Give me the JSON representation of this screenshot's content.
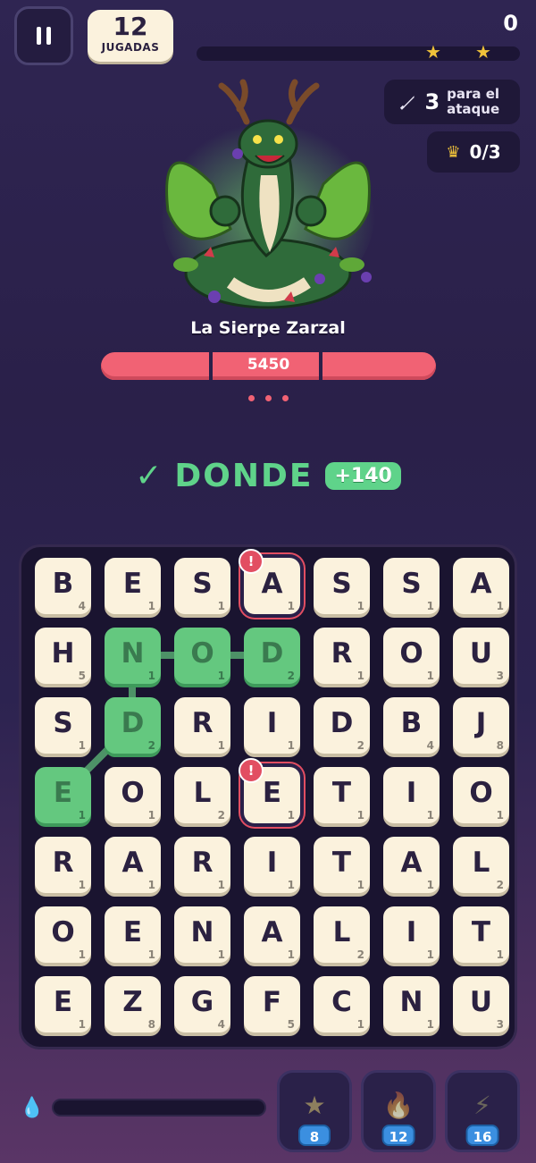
{
  "hud": {
    "moves": "12",
    "moves_label": "JUGADAS",
    "score": "0",
    "attack_count": "3",
    "attack_label": "para el ataque",
    "crowns": "0/3"
  },
  "boss": {
    "name": "La Sierpe Zarzal",
    "hp": "5450"
  },
  "current_word": {
    "word": "DONDE",
    "bonus": "+140"
  },
  "board": {
    "rows": [
      [
        {
          "l": "B",
          "v": "4"
        },
        {
          "l": "E",
          "v": "1"
        },
        {
          "l": "S",
          "v": "1"
        },
        {
          "l": "A",
          "v": "1",
          "warn": true
        },
        {
          "l": "S",
          "v": "1"
        },
        {
          "l": "S",
          "v": "1"
        },
        {
          "l": "A",
          "v": "1"
        }
      ],
      [
        {
          "l": "H",
          "v": "5"
        },
        {
          "l": "N",
          "v": "1",
          "sel": true
        },
        {
          "l": "O",
          "v": "1",
          "sel": true
        },
        {
          "l": "D",
          "v": "2",
          "sel": true
        },
        {
          "l": "R",
          "v": "1"
        },
        {
          "l": "O",
          "v": "1"
        },
        {
          "l": "U",
          "v": "3"
        }
      ],
      [
        {
          "l": "S",
          "v": "1"
        },
        {
          "l": "D",
          "v": "2",
          "sel": true
        },
        {
          "l": "R",
          "v": "1"
        },
        {
          "l": "I",
          "v": "1"
        },
        {
          "l": "D",
          "v": "2"
        },
        {
          "l": "B",
          "v": "4"
        },
        {
          "l": "J",
          "v": "8"
        }
      ],
      [
        {
          "l": "E",
          "v": "1",
          "sel": true
        },
        {
          "l": "O",
          "v": "1"
        },
        {
          "l": "L",
          "v": "2"
        },
        {
          "l": "E",
          "v": "1",
          "warn": true
        },
        {
          "l": "T",
          "v": "1"
        },
        {
          "l": "I",
          "v": "1"
        },
        {
          "l": "O",
          "v": "1"
        }
      ],
      [
        {
          "l": "R",
          "v": "1"
        },
        {
          "l": "A",
          "v": "1"
        },
        {
          "l": "R",
          "v": "1"
        },
        {
          "l": "I",
          "v": "1"
        },
        {
          "l": "T",
          "v": "1"
        },
        {
          "l": "A",
          "v": "1"
        },
        {
          "l": "L",
          "v": "2"
        }
      ],
      [
        {
          "l": "O",
          "v": "1"
        },
        {
          "l": "E",
          "v": "1"
        },
        {
          "l": "N",
          "v": "1"
        },
        {
          "l": "A",
          "v": "1"
        },
        {
          "l": "L",
          "v": "2"
        },
        {
          "l": "I",
          "v": "1"
        },
        {
          "l": "T",
          "v": "1"
        }
      ],
      [
        {
          "l": "E",
          "v": "1"
        },
        {
          "l": "Z",
          "v": "8"
        },
        {
          "l": "G",
          "v": "4"
        },
        {
          "l": "F",
          "v": "5"
        },
        {
          "l": "C",
          "v": "1"
        },
        {
          "l": "N",
          "v": "1"
        },
        {
          "l": "U",
          "v": "3"
        }
      ]
    ],
    "warn_badge": "!"
  },
  "powerups": [
    {
      "icon": "star-icon",
      "glyph": "★",
      "count": "8"
    },
    {
      "icon": "fire-icon",
      "glyph": "🔥",
      "count": "12"
    },
    {
      "icon": "lightning-icon",
      "glyph": "⚡",
      "count": "16"
    }
  ],
  "colors": {
    "accent_green": "#5fd38a",
    "hp_red": "#f16274",
    "tile_cream": "#fbf2dd",
    "badge_blue": "#3b8fe0"
  }
}
